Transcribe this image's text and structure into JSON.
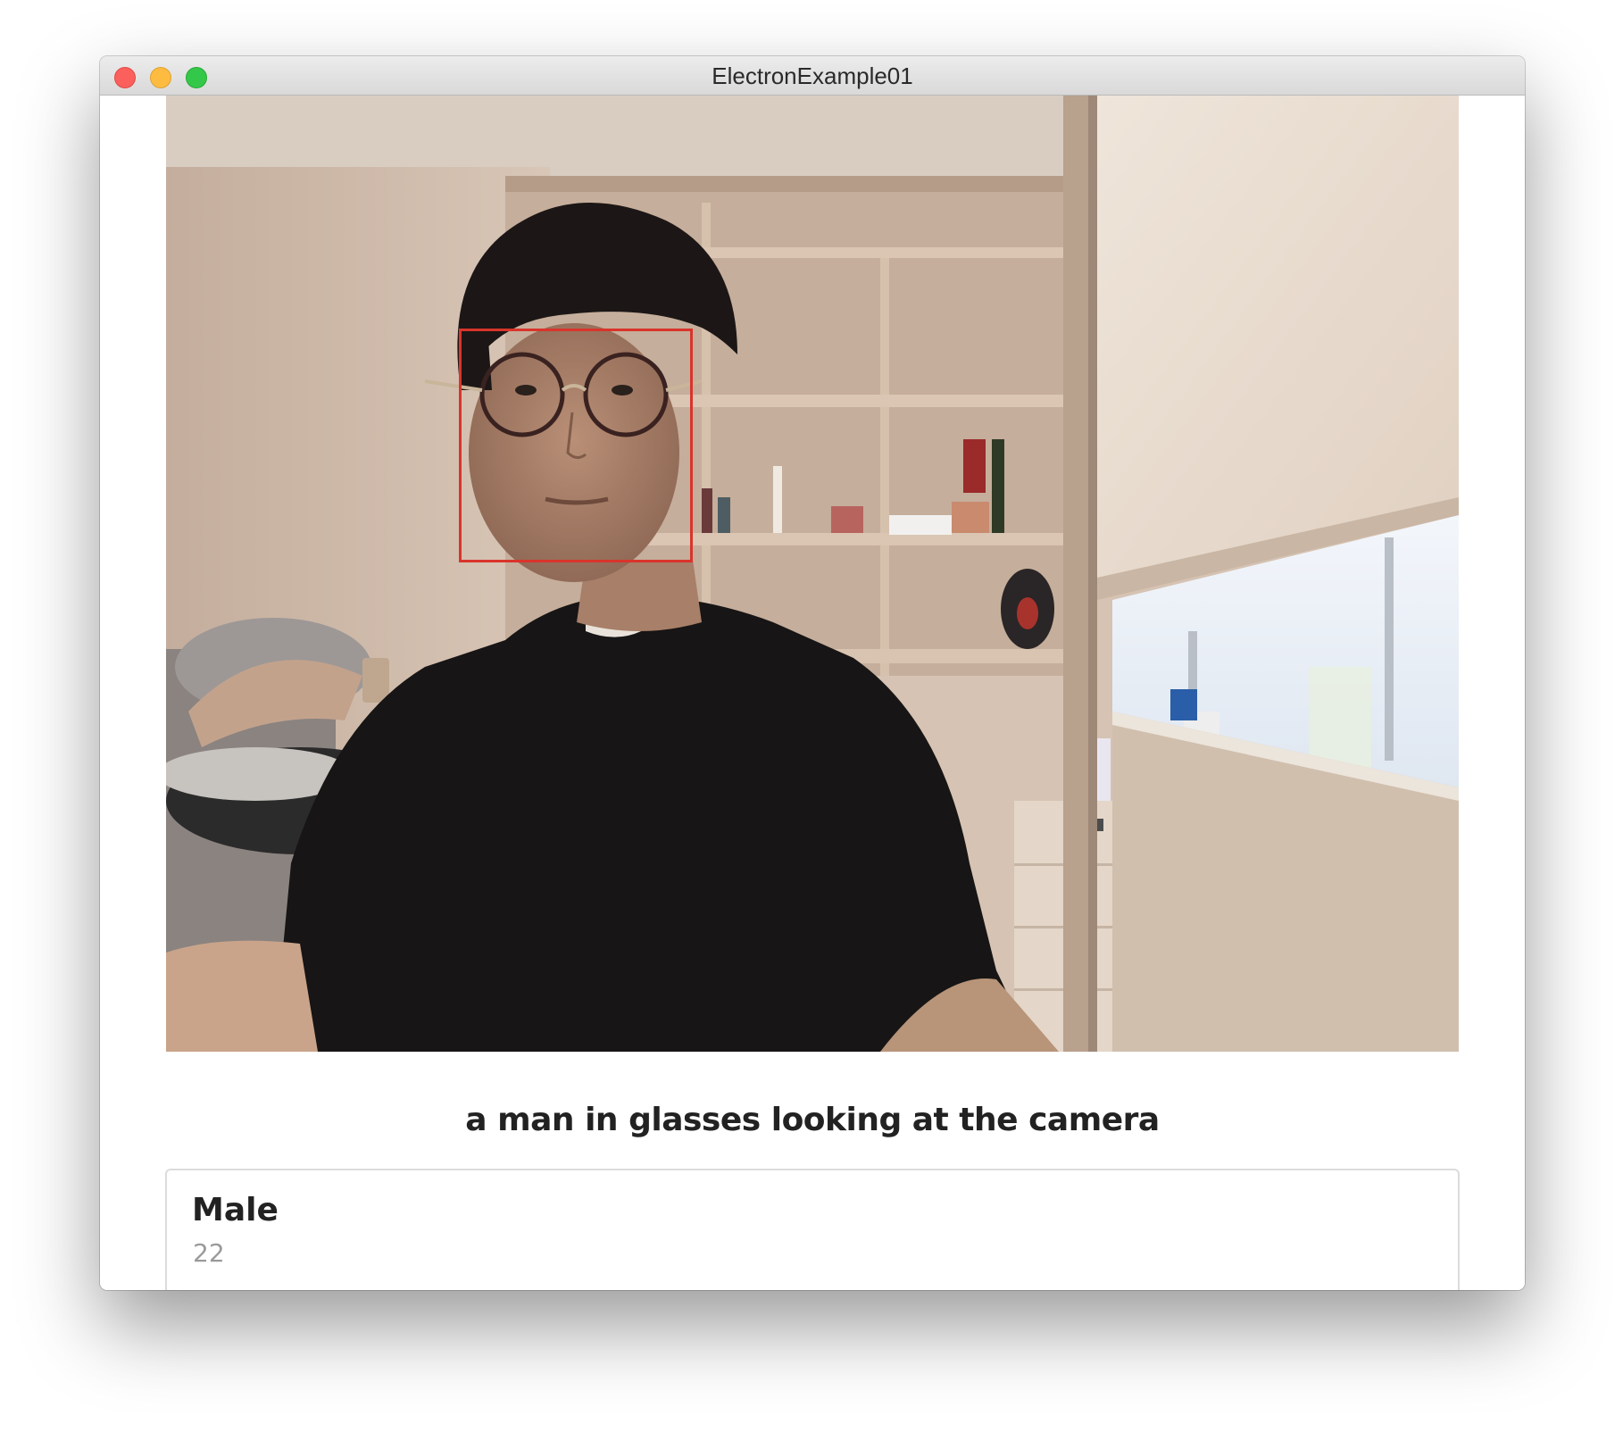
{
  "window": {
    "title": "ElectronExample01"
  },
  "camera": {
    "alt": "a man in glasses looking at the camera"
  },
  "detection": {
    "caption": "a man in glasses looking at the camera",
    "box_color": "#d9342b",
    "gender": "Male",
    "age": "22"
  }
}
